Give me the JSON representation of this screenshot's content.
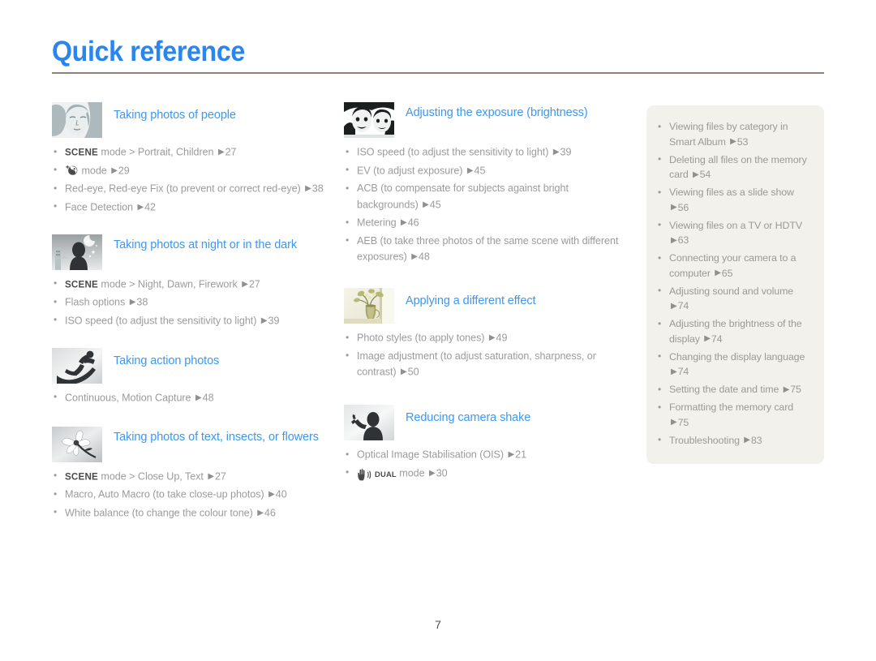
{
  "header": {
    "title": "Quick reference"
  },
  "folio": "7",
  "colors": {
    "title_blue": "#2b85ef",
    "section_blue": "#3c98f0",
    "body_gray": "#9b9b9b",
    "lead_dark": "#4a4a4a",
    "rule": "#8d8178",
    "panel_bg": "#f3f1ec"
  },
  "columns": {
    "left": [
      {
        "thumb_name": "portrait-face-thumbnail",
        "title": "Taking photos of people",
        "items": [
          {
            "lead": "SCENE",
            "text": " mode > Portrait, Children ",
            "arrow": true,
            "page": "27"
          },
          {
            "icon": "beauty-shot-icon",
            "text": " mode ",
            "arrow": true,
            "page": "29"
          },
          {
            "text": "Red-eye, Red-eye Fix (to prevent or correct red-eye) ",
            "arrow": true,
            "page": "38"
          },
          {
            "text": "Face Detection ",
            "arrow": true,
            "page": "42"
          }
        ]
      },
      {
        "thumb_name": "night-scene-thumbnail",
        "title": "Taking photos at night or in the dark",
        "items": [
          {
            "lead": "SCENE",
            "text": " mode > Night, Dawn, Firework ",
            "arrow": true,
            "page": "27"
          },
          {
            "text": "Flash options ",
            "arrow": true,
            "page": "38"
          },
          {
            "text": "ISO speed (to adjust the sensitivity to light) ",
            "arrow": true,
            "page": "39"
          }
        ]
      },
      {
        "thumb_name": "snowboarder-action-thumbnail",
        "title": "Taking action photos",
        "items": [
          {
            "text": "Continuous, Motion Capture ",
            "arrow": true,
            "page": "48"
          }
        ]
      },
      {
        "thumb_name": "flower-macro-thumbnail",
        "title": "Taking photos of text, insects, or flowers",
        "items": [
          {
            "lead": "SCENE",
            "text": " mode > Close Up, Text ",
            "arrow": true,
            "page": "27"
          },
          {
            "text": "Macro, Auto Macro (to take close-up photos) ",
            "arrow": true,
            "page": "40"
          },
          {
            "text": "White balance (to change the colour tone) ",
            "arrow": true,
            "page": "46"
          }
        ]
      }
    ],
    "middle": [
      {
        "thumb_name": "two-faces-exposure-thumbnail",
        "title": "Adjusting the exposure (brightness)",
        "items": [
          {
            "text": "ISO speed (to adjust the sensitivity to light) ",
            "arrow": true,
            "page": "39"
          },
          {
            "text": "EV (to adjust exposure) ",
            "arrow": true,
            "page": "45"
          },
          {
            "text": "ACB (to compensate for subjects against bright backgrounds) ",
            "arrow": true,
            "page": "45"
          },
          {
            "text": "Metering ",
            "arrow": true,
            "page": "46"
          },
          {
            "text": "AEB (to take three photos of the same scene with different exposures) ",
            "arrow": true,
            "page": "48"
          }
        ]
      },
      {
        "thumb_name": "vase-flowers-effect-thumbnail",
        "title": "Applying a different effect",
        "items": [
          {
            "text": "Photo styles (to apply tones) ",
            "arrow": true,
            "page": "49"
          },
          {
            "text": "Image adjustment (to adjust saturation, sharpness, or contrast) ",
            "arrow": true,
            "page": "50"
          }
        ]
      },
      {
        "thumb_name": "camera-shake-thumbnail",
        "title": "Reducing camera shake",
        "items": [
          {
            "text": "Optical Image Stabilisation (OIS) ",
            "arrow": true,
            "page": "21"
          },
          {
            "icon": "dual-is-icon",
            "text": " mode ",
            "arrow": true,
            "page": "30"
          }
        ]
      }
    ],
    "right_panel": [
      {
        "text": "Viewing files by category in Smart Album ",
        "arrow": true,
        "page": "53"
      },
      {
        "text": "Deleting all files on the memory card ",
        "arrow": true,
        "page": "54"
      },
      {
        "text": "Viewing files as a slide show ",
        "arrow": true,
        "page": "56"
      },
      {
        "text": "Viewing files on a TV or HDTV ",
        "arrow": true,
        "page": "63"
      },
      {
        "text": "Connecting your camera to a computer ",
        "arrow": true,
        "page": "65"
      },
      {
        "text": "Adjusting sound and volume ",
        "arrow": true,
        "page": "74"
      },
      {
        "text": "Adjusting the brightness of the display ",
        "arrow": true,
        "page": "74"
      },
      {
        "text": "Changing the display language ",
        "arrow": true,
        "page": "74"
      },
      {
        "text": "Setting the date and time ",
        "arrow": true,
        "page": "75"
      },
      {
        "text": "Formatting the memory card ",
        "arrow": true,
        "page": "75"
      },
      {
        "text": "Troubleshooting ",
        "arrow": true,
        "page": "83"
      }
    ]
  }
}
